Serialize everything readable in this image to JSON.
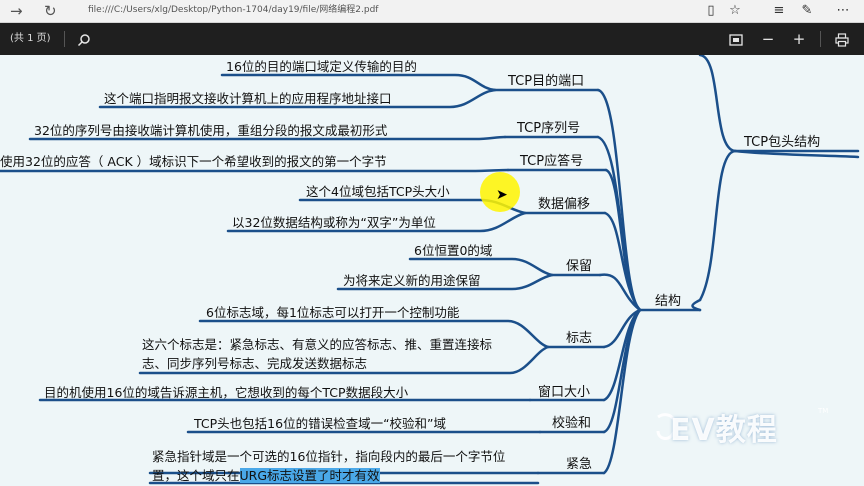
{
  "browser": {
    "url": "file:///C:/Users/xlg/Desktop/Python-1704/day19/file/网络编程2.pdf",
    "icons": [
      "back-icon",
      "refresh-icon",
      "reading-view-icon",
      "favorite-star-icon",
      "hub-icon",
      "notes-icon",
      "more-icon"
    ]
  },
  "pdf_toolbar": {
    "page_count": "(共 1 页)",
    "icons": [
      "search-icon",
      "fit-page-icon",
      "zoom-out-icon",
      "zoom-in-icon",
      "print-icon"
    ]
  },
  "mindmap": {
    "root": "TCP包头结构",
    "structure": "结构",
    "sections": [
      {
        "label": "TCP目的端口",
        "items": [
          "16位的目的端口域定义传输的目的",
          "这个端口指明报文接收计算机上的应用程序地址接口"
        ]
      },
      {
        "label": "TCP序列号",
        "items": [
          "32位的序列号由接收端计算机使用，重组分段的报文成最初形式"
        ]
      },
      {
        "label": "TCP应答号",
        "items": [
          "使用32位的应答（ ACK ）域标识下一个希望收到的报文的第一个字节"
        ]
      },
      {
        "label": "数据偏移",
        "items": [
          "这个4位域包括TCP头大小",
          "以32位数据结构或称为“双字”为单位"
        ]
      },
      {
        "label": "保留",
        "items": [
          "6位恒置0的域",
          "为将来定义新的用途保留"
        ]
      },
      {
        "label": "标志",
        "items": [
          "6位标志域，每1位标志可以打开一个控制功能",
          "这六个标志是：紧急标志、有意义的应答标志、推、重置连接标志、同步序列号标志、完成发送数据标志"
        ]
      },
      {
        "label": "窗口大小",
        "items": [
          "目的机使用16位的域告诉源主机，它想收到的每个TCP数据段大小"
        ]
      },
      {
        "label": "校验和",
        "items": [
          "TCP头也包括16位的错误检查域一“校验和”域"
        ]
      },
      {
        "label": "紧急",
        "items": [
          "紧急指针域是一个可选的16位指针，指向段内的最后一个字节位置，这个域只在",
          "URG标志设置了时才有效"
        ]
      }
    ]
  },
  "watermark": {
    "text": "EV教程",
    "tm": "TM"
  },
  "colors": {
    "line": "#1b4f8a",
    "toolbar": "#1f1f1f",
    "background": "#eef6f8",
    "highlight": "#4aa8e8",
    "cursor": "#fff500"
  }
}
